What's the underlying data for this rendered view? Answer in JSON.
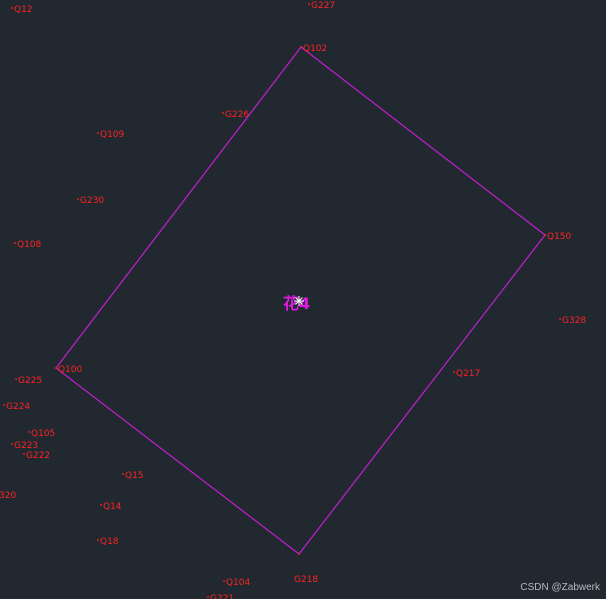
{
  "watermark": "CSDN @Zabwerk",
  "colors": {
    "background": "#212830",
    "point_label": "#ff2323",
    "polygon": "#c21fcf",
    "center_text": "#e11be4",
    "cursor": "#ffffff"
  },
  "center_label": "花4",
  "polygon_vertices": [
    "Q102",
    "Q150",
    "G218",
    "Q100"
  ],
  "points": [
    {
      "id": "Q12",
      "label": "Q12"
    },
    {
      "id": "G227",
      "label": "G227"
    },
    {
      "id": "Q102",
      "label": "Q102"
    },
    {
      "id": "G226",
      "label": "G226"
    },
    {
      "id": "Q109",
      "label": "Q109"
    },
    {
      "id": "G230",
      "label": "G230"
    },
    {
      "id": "Q108",
      "label": "Q108"
    },
    {
      "id": "Q150",
      "label": "Q150"
    },
    {
      "id": "G328",
      "label": "G328"
    },
    {
      "id": "G225",
      "label": "G225"
    },
    {
      "id": "Q100",
      "label": "Q100"
    },
    {
      "id": "Q217",
      "label": "Q217"
    },
    {
      "id": "G224",
      "label": "G224"
    },
    {
      "id": "Q105",
      "label": "Q105"
    },
    {
      "id": "G223",
      "label": "G223"
    },
    {
      "id": "G222",
      "label": "G222"
    },
    {
      "id": "Q15",
      "label": "Q15"
    },
    {
      "id": "320",
      "label": "320"
    },
    {
      "id": "Q14",
      "label": "Q14"
    },
    {
      "id": "Q18",
      "label": "Q18"
    },
    {
      "id": "Q104",
      "label": "Q104"
    },
    {
      "id": "G218",
      "label": "G218"
    },
    {
      "id": "G221",
      "label": "G221"
    }
  ]
}
